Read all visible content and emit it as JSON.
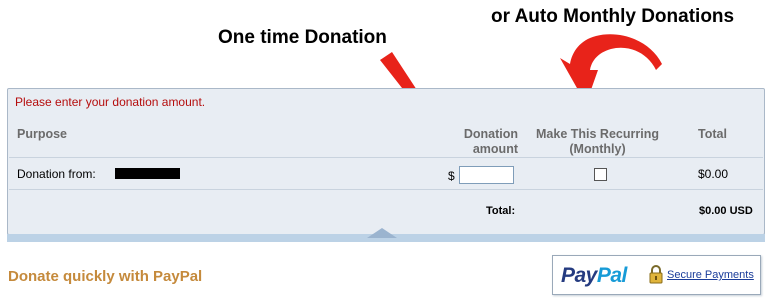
{
  "annotations": {
    "one_time": "One time Donation",
    "auto_monthly": "or Auto Monthly Donations"
  },
  "form": {
    "error_message": "Please enter your donation amount.",
    "headers": {
      "purpose": "Purpose",
      "amount_line1": "Donation",
      "amount_line2": "amount",
      "recurring_line1": "Make This Recurring",
      "recurring_line2": "(Monthly)",
      "total": "Total"
    },
    "row": {
      "donor_label": "Donation from:",
      "currency_symbol": "$",
      "amount_value": "",
      "recurring_checked": false,
      "total": "$0.00"
    },
    "footer": {
      "total_label": "Total:",
      "grand_total": "$0.00  USD"
    }
  },
  "donate": {
    "heading": "Donate quickly with PayPal",
    "paypal_pay": "Pay",
    "paypal_pal": "Pal",
    "secure_label": "Secure Payments"
  },
  "colors": {
    "annotation_arrow": "#e8231a",
    "error_text": "#b50d0d",
    "panel_bg": "#e8edf3",
    "heading_orange": "#c58a3c",
    "paypal_dark_blue": "#253b80",
    "paypal_light_blue": "#179bd7"
  }
}
